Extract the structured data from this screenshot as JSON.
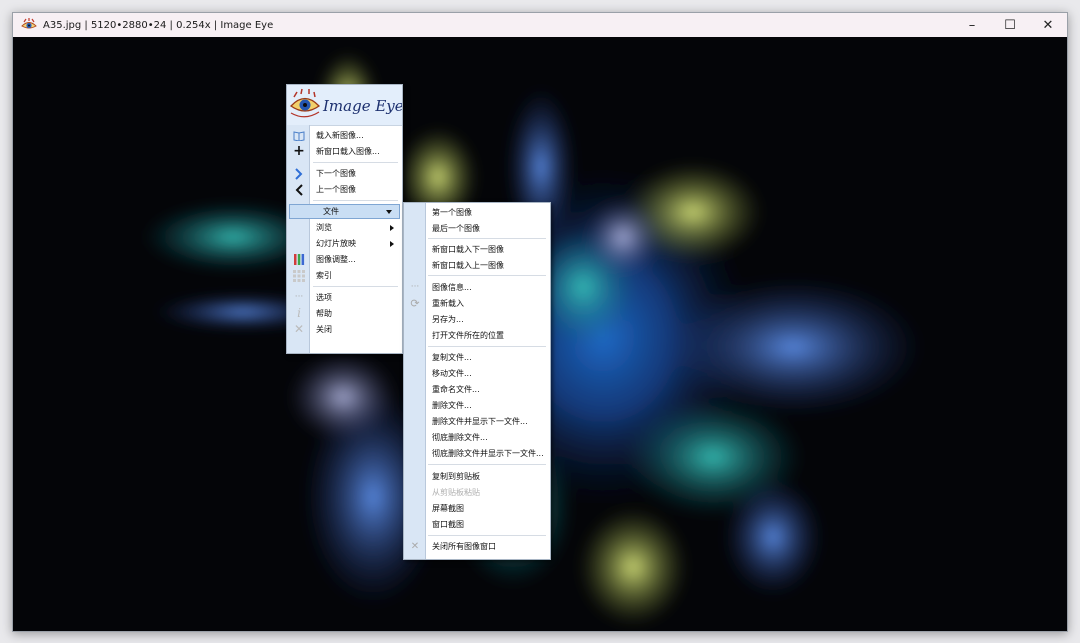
{
  "window": {
    "title": "A35.jpg | 5120•2880•24 | 0.254x | Image Eye",
    "controls": {
      "minimize": "–",
      "maximize": "☐",
      "close": "✕"
    }
  },
  "banner": {
    "logo_text": "Image Eye"
  },
  "main_menu": {
    "items": [
      {
        "label": "载入新图像...",
        "icon": "book-icon"
      },
      {
        "label": "新窗口载入图像...",
        "icon": "plus-icon"
      },
      {
        "label": "下一个图像",
        "icon": "chevron-right-icon"
      },
      {
        "label": "上一个图像",
        "icon": "chevron-left-icon"
      },
      {
        "label": "文件",
        "highlighted": true
      },
      {
        "label": "浏览",
        "submenu": true
      },
      {
        "label": "幻灯片放映",
        "submenu": true
      },
      {
        "label": "图像调整...",
        "icon": "color-bars-icon"
      },
      {
        "label": "索引",
        "icon": "grid-icon"
      },
      {
        "label": "选项",
        "icon": "more-icon"
      },
      {
        "label": "帮助",
        "icon": "info-icon"
      },
      {
        "label": "关闭",
        "icon": "close-icon"
      }
    ]
  },
  "file_submenu": {
    "items": [
      "第一个图像",
      "最后一个图像",
      "新窗口载入下一图像",
      "新窗口载入上一图像",
      "图像信息...",
      "重新载入",
      "另存为...",
      "打开文件所在的位置",
      "复制文件...",
      "移动文件...",
      "重命名文件...",
      "删除文件...",
      "删除文件并显示下一文件...",
      "彻底删除文件...",
      "彻底删除文件并显示下一文件...",
      "复制到剪贴板",
      "从剪贴板粘贴",
      "屏幕截图",
      "窗口截图",
      "关闭所有图像窗口"
    ]
  },
  "colors": {
    "accent": "#2f6fd6",
    "gutter": "#d9e6f5",
    "highlight": "#c9def4"
  }
}
